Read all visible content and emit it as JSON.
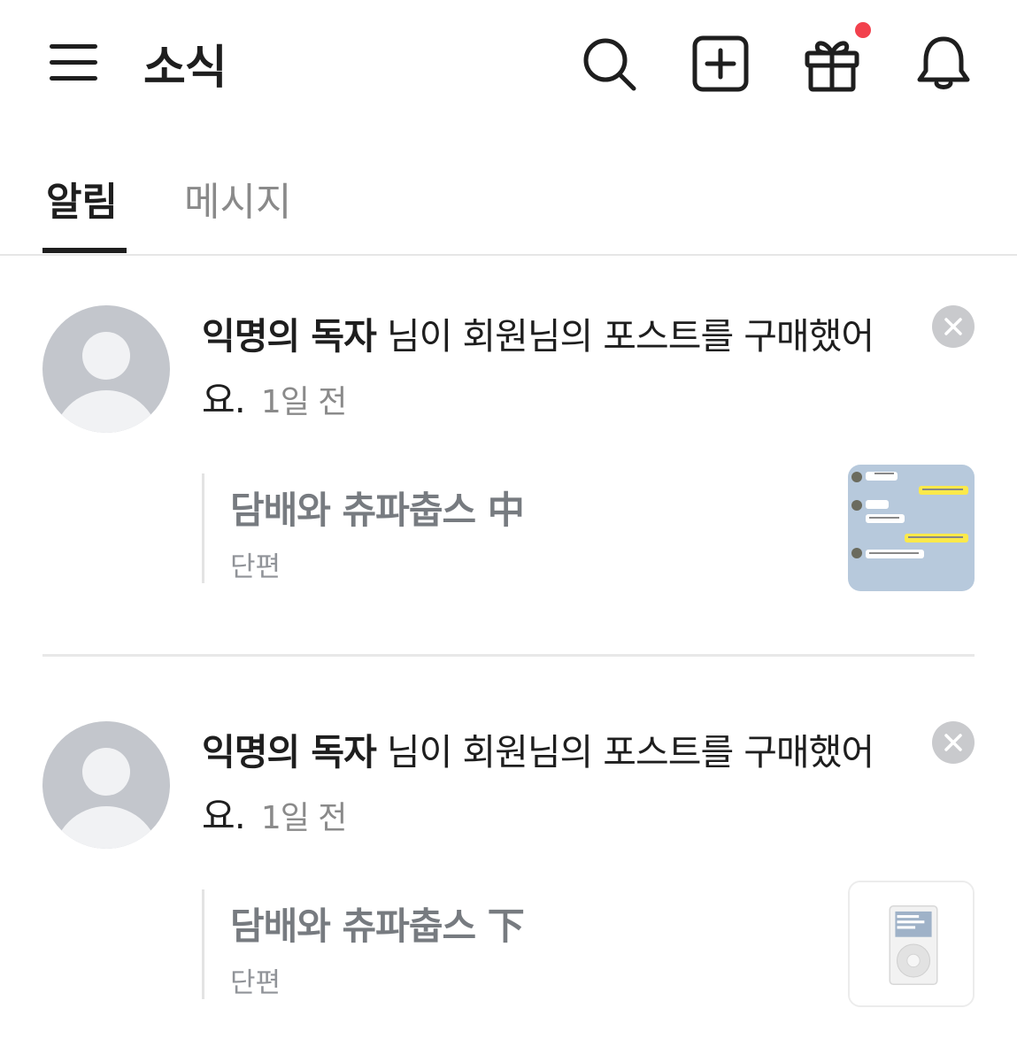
{
  "header": {
    "title": "소식",
    "icons": {
      "menu": "menu-icon",
      "search": "search-icon",
      "add": "plus-square-icon",
      "gift": "gift-icon",
      "notifications": "bell-icon"
    },
    "gift_badge_color": "#f2414d"
  },
  "tabs": [
    {
      "label": "알림",
      "active": true
    },
    {
      "label": "메시지",
      "active": false
    }
  ],
  "notifications": [
    {
      "actor": "익명의 독자",
      "message": " 님이 회원님의 포스트를 구매했어요.",
      "time": "1일 전",
      "post": {
        "title": "담배와 츄파춥스 中",
        "type": "단편"
      },
      "thumbnail": "chat-screenshot-thumbnail"
    },
    {
      "actor": "익명의 독자",
      "message": " 님이 회원님의 포스트를 구매했어요.",
      "time": "1일 전",
      "post": {
        "title": "담배와 츄파춥스 下",
        "type": "단편"
      },
      "thumbnail": "music-player-thumbnail"
    }
  ],
  "colors": {
    "text_primary": "#1e1e1e",
    "text_secondary": "#8a8a8a",
    "divider": "#e6e6e6"
  }
}
